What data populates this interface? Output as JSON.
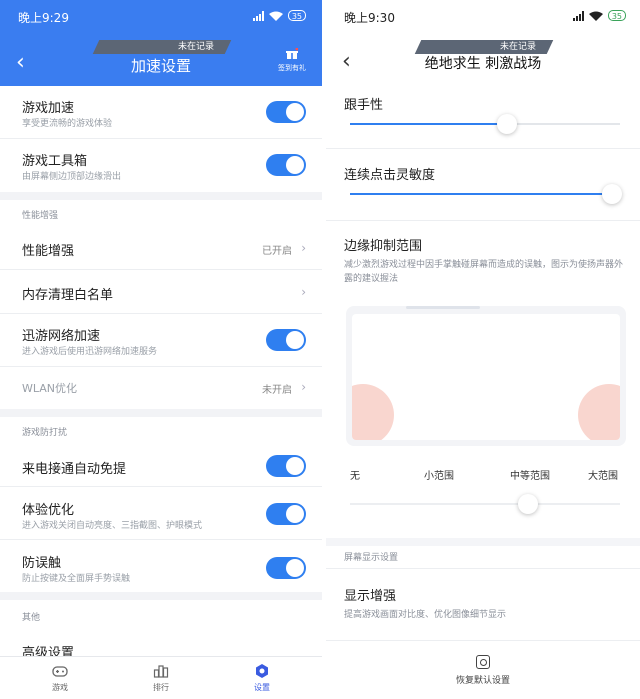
{
  "left": {
    "status": {
      "time": "晚上9:29",
      "battery": "35"
    },
    "header": {
      "banner": "未在记录",
      "title": "加速设置",
      "gift_label": "签到有礼"
    },
    "rows": {
      "game_accel": {
        "title": "游戏加速",
        "subtitle": "享受更流畅的游戏体验",
        "on": true
      },
      "toolbox": {
        "title": "游戏工具箱",
        "subtitle": "由屏幕侧边顶部边缘滑出",
        "on": true
      },
      "perf": {
        "title": "性能增强",
        "value": "已开启"
      },
      "whitelist": {
        "title": "内存清理白名单"
      },
      "xunyou": {
        "title": "迅游网络加速",
        "subtitle": "进入游戏后使用迅游网络加速服务",
        "on": true
      },
      "wlan": {
        "title": "WLAN优化",
        "value": "未开启"
      },
      "call": {
        "title": "来电接通自动免提",
        "on": true
      },
      "experience": {
        "title": "体验优化",
        "subtitle": "进入游戏关闭自动亮度、三指截图、护眼模式",
        "on": true
      },
      "mistouch": {
        "title": "防误触",
        "subtitle": "防止按键及全面屏手势误触",
        "on": true
      },
      "advanced": {
        "title": "高级设置"
      }
    },
    "sections": {
      "perf": "性能增强",
      "anti": "游戏防打扰",
      "other": "其他"
    },
    "tabs": {
      "game": "游戏",
      "rank": "排行",
      "settings": "设置"
    }
  },
  "right": {
    "status": {
      "time": "晚上9:30",
      "battery": "35"
    },
    "header": {
      "banner": "未在记录",
      "title": "绝地求生 刺激战场"
    },
    "follow": {
      "label": "跟手性",
      "value": 0.58
    },
    "tap": {
      "label": "连续点击灵敏度",
      "value": 0.97
    },
    "edge": {
      "label": "边缘抑制范围",
      "desc": "减少激烈游戏过程中因手掌触碰屏幕而造成的误触，图示为使扬声器外露的建议握法",
      "range_labels": [
        "无",
        "小范围",
        "中等范围",
        "大范围"
      ],
      "value": 0.66
    },
    "display_section": "屏幕显示设置",
    "enhance": {
      "title": "显示增强",
      "desc": "提高游戏画面对比度、优化图像细节显示"
    },
    "reset_label": "恢复默认设置"
  },
  "colors": {
    "accent": "#2f7ff0",
    "header_bg": "#3a7df0",
    "arc": "#f9d6cf"
  }
}
